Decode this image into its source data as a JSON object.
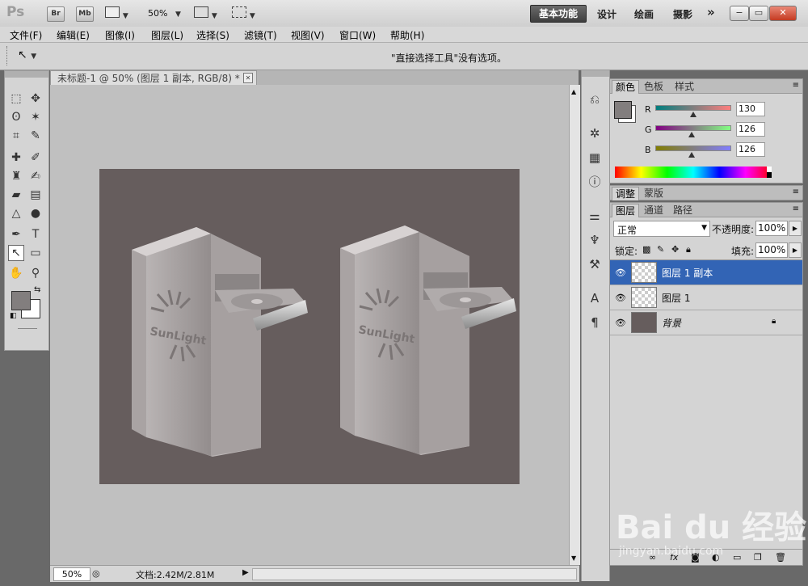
{
  "app": {
    "logo": "Ps",
    "bridge_btn": "Br",
    "minibridge_btn": "Mb",
    "zoom_select": "50%",
    "workspaces": [
      "基本功能",
      "设计",
      "绘画",
      "摄影"
    ],
    "more": "»",
    "win_minimize": "−",
    "win_restore": "▭",
    "win_close": "✕"
  },
  "menu": [
    "文件(F)",
    "编辑(E)",
    "图像(I)",
    "图层(L)",
    "选择(S)",
    "滤镜(T)",
    "视图(V)",
    "窗口(W)",
    "帮助(H)"
  ],
  "options": {
    "message": "\"直接选择工具\"没有选项。"
  },
  "document": {
    "tab_title": "未标题-1 @ 50% (图层 1 副本, RGB/8) *",
    "tab_close": "✕",
    "zoom": "50%",
    "doc_info": "文档:2.42M/2.81M",
    "artwork_text": "SunLight"
  },
  "color_panel": {
    "tabs": [
      "颜色",
      "色板",
      "样式"
    ],
    "channels": [
      {
        "name": "R",
        "value": "130",
        "level": 0.51
      },
      {
        "name": "G",
        "value": "126",
        "level": 0.49
      },
      {
        "name": "B",
        "value": "126",
        "level": 0.49
      }
    ],
    "foreground": "#827e7e"
  },
  "adjust_panel": {
    "tabs": [
      "调整",
      "蒙版"
    ]
  },
  "layers_panel": {
    "tabs": [
      "图层",
      "通道",
      "路径"
    ],
    "blend_mode": "正常",
    "opacity_label": "不透明度:",
    "opacity": "100%",
    "lock_label": "锁定:",
    "fill_label": "填充:",
    "fill": "100%",
    "layers": [
      {
        "name": "图层 1 副本",
        "selected": true
      },
      {
        "name": "图层 1",
        "selected": false
      },
      {
        "name": "背景",
        "selected": false
      }
    ]
  },
  "watermark": {
    "text": "Bai du 经验",
    "url": "jingyan.baidu.com"
  }
}
